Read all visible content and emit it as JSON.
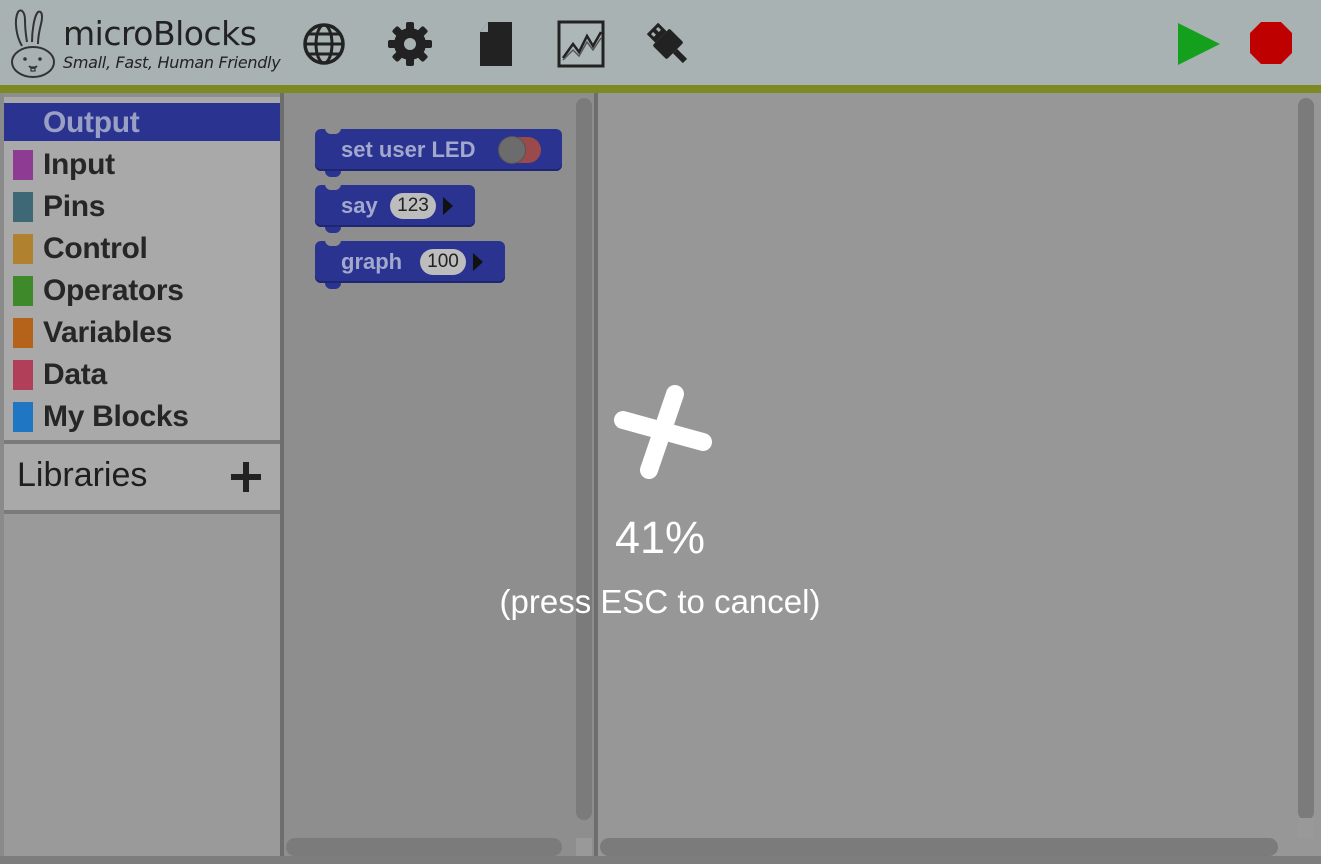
{
  "app": {
    "title": "microBlocks",
    "tagline": "Small, Fast, Human Friendly"
  },
  "toolbar": {
    "icons": [
      "globe-icon",
      "gear-icon",
      "file-icon",
      "graph-icon",
      "usb-icon",
      "run-icon",
      "stop-icon"
    ],
    "run_color": "#14a01c",
    "stop_color": "#bf0000",
    "stripe_color": "#7d8a24"
  },
  "categories": [
    {
      "label": "Output",
      "color": "#2b3391",
      "selected": true
    },
    {
      "label": "Input",
      "color": "#8e3b94"
    },
    {
      "label": "Pins",
      "color": "#3f6877"
    },
    {
      "label": "Control",
      "color": "#b08230"
    },
    {
      "label": "Operators",
      "color": "#3e8a2a"
    },
    {
      "label": "Variables",
      "color": "#b5621b"
    },
    {
      "label": "Data",
      "color": "#b23f5a"
    },
    {
      "label": "My Blocks",
      "color": "#1f77c4"
    }
  ],
  "libraries": {
    "label": "Libraries",
    "add_symbol": "+"
  },
  "palette": {
    "blocks": [
      {
        "label": "set user LED",
        "toggle": false
      },
      {
        "label": "say",
        "arg": "123"
      },
      {
        "label": "graph",
        "arg": "100"
      }
    ]
  },
  "progress": {
    "percent_text": "41%",
    "hint": "(press ESC to cancel)",
    "value": 0.41
  }
}
